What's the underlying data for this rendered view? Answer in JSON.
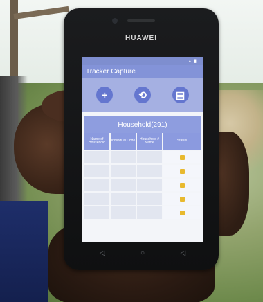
{
  "phone": {
    "brand": "HUAWEI"
  },
  "status_bar": {
    "time": ""
  },
  "app": {
    "title": "Tracker Capture",
    "actions": [
      {
        "name": "add-button",
        "icon": "plus-icon",
        "glyph": "+"
      },
      {
        "name": "sync-button",
        "icon": "sync-icon",
        "glyph": "⟲"
      },
      {
        "name": "report-button",
        "icon": "report-icon",
        "glyph": "▤"
      }
    ]
  },
  "table": {
    "title": "Household(291)",
    "columns": [
      "Name of Household",
      "Individual Code",
      "Household # Name",
      "Status"
    ],
    "rows": [
      [
        "",
        "",
        "",
        ""
      ],
      [
        "",
        "",
        "",
        ""
      ],
      [
        "",
        "",
        "",
        ""
      ],
      [
        "",
        "",
        "",
        ""
      ],
      [
        "",
        "",
        "",
        ""
      ]
    ]
  },
  "colors": {
    "app_bar": "#8393d8",
    "action_row": "#a5b0e2",
    "action_button": "#6476cf",
    "status_indicator": "#e8b92e"
  },
  "nav": [
    "back-icon",
    "home-icon",
    "recent-apps-icon"
  ]
}
